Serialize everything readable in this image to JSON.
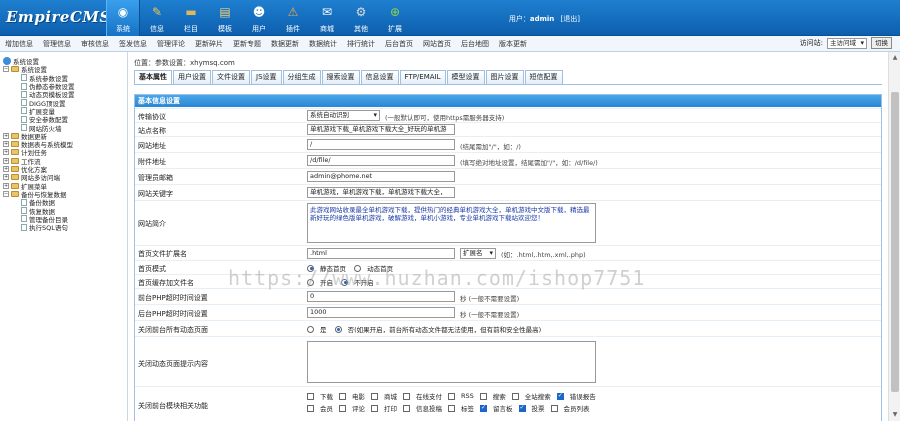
{
  "header": {
    "logo": "EmpireCMS",
    "nav": [
      {
        "label": "系统",
        "icon": "system-icon",
        "color": "#ffffff"
      },
      {
        "label": "信息",
        "icon": "edit-icon",
        "color": "#f3c64a"
      },
      {
        "label": "栏目",
        "icon": "folder-icon",
        "color": "#e0b85a"
      },
      {
        "label": "模板",
        "icon": "template-icon",
        "color": "#f1d27a"
      },
      {
        "label": "用户",
        "icon": "user-icon",
        "color": "#ffffff"
      },
      {
        "label": "插件",
        "icon": "plugin-icon",
        "color": "#f0a64a"
      },
      {
        "label": "商城",
        "icon": "shop-icon",
        "color": "#ffffff"
      },
      {
        "label": "其他",
        "icon": "gear-icon",
        "color": "#dddddd"
      },
      {
        "label": "扩展",
        "icon": "plus-icon",
        "color": "#8bd34a"
      }
    ],
    "user_prefix": "用户：",
    "user_name": "admin",
    "logout": "[退出]"
  },
  "menubar": {
    "items": [
      "增加信息",
      "管理信息",
      "审核信息",
      "签发信息",
      "管理评论",
      "更新碎片",
      "更新专题",
      "数据更新",
      "数据统计",
      "排行统计",
      "后台首页",
      "网站首页",
      "后台地图",
      "版本更新"
    ],
    "visit_label": "访问站:",
    "visit_value": "主访问域",
    "switch_button": "切换"
  },
  "sidebar": {
    "items": [
      {
        "label": "系统设置",
        "level": 0,
        "type": "root"
      },
      {
        "label": "系统设置",
        "level": 1,
        "type": "folder",
        "exp": "−"
      },
      {
        "label": "系统参数设置",
        "level": 2,
        "type": "doc"
      },
      {
        "label": "伪静态参数设置",
        "level": 2,
        "type": "doc"
      },
      {
        "label": "动态页模板设置",
        "level": 2,
        "type": "doc"
      },
      {
        "label": "DIGG顶设置",
        "level": 2,
        "type": "doc"
      },
      {
        "label": "扩展变量",
        "level": 2,
        "type": "doc"
      },
      {
        "label": "安全参数配置",
        "level": 2,
        "type": "doc"
      },
      {
        "label": "网站防火墙",
        "level": 2,
        "type": "doc"
      },
      {
        "label": "数据更新",
        "level": 1,
        "type": "folder",
        "exp": "+"
      },
      {
        "label": "数据表与系统模型",
        "level": 1,
        "type": "folder",
        "exp": "+"
      },
      {
        "label": "计划任务",
        "level": 1,
        "type": "folder",
        "exp": "+"
      },
      {
        "label": "工作流",
        "level": 1,
        "type": "folder",
        "exp": "+"
      },
      {
        "label": "优化方案",
        "level": 1,
        "type": "folder",
        "exp": "+"
      },
      {
        "label": "网站多访问端",
        "level": 1,
        "type": "folder",
        "exp": "+"
      },
      {
        "label": "扩展菜单",
        "level": 1,
        "type": "folder",
        "exp": "+"
      },
      {
        "label": "备份与恢复数据",
        "level": 1,
        "type": "folder",
        "exp": "−"
      },
      {
        "label": "备份数据",
        "level": 2,
        "type": "doc"
      },
      {
        "label": "恢复数据",
        "level": 2,
        "type": "doc"
      },
      {
        "label": "管理备份目录",
        "level": 2,
        "type": "doc"
      },
      {
        "label": "执行SQL语句",
        "level": 2,
        "type": "doc"
      }
    ]
  },
  "main": {
    "location_label": "位置：",
    "location_value": "参数设置：xhymsq.com",
    "tabs": [
      "基本属性",
      "用户设置",
      "文件设置",
      "JS设置",
      "分组生成",
      "搜索设置",
      "信息设置",
      "FTP/EMAIL",
      "模型设置",
      "图片设置",
      "短信配置"
    ],
    "section_title": "基本信息设置",
    "rows": {
      "protocol": {
        "label": "传输协议",
        "value": "系统自动识别",
        "hint": "(一般默认即可，使用https需服务器支持)"
      },
      "sitename": {
        "label": "站点名称",
        "value": "单机游戏下载_单机游戏下载大全_好玩的单机游"
      },
      "siteurl": {
        "label": "网站地址",
        "value": "/",
        "hint": "(结尾需加\"/\"，如：/)"
      },
      "fileurl": {
        "label": "附件地址",
        "value": "/d/file/",
        "hint": "(填写绝对地址设置，结尾需加\"/\"，如：/d/file/)"
      },
      "email": {
        "label": "管理员邮箱",
        "value": "admin@phome.net"
      },
      "keywords": {
        "label": "网站关键字",
        "value": "单机游戏，单机游戏下载，单机游戏下载大全，"
      },
      "intro": {
        "label": "网站简介",
        "value": "此游戏网站收录最全单机游戏下载，提供热门的经典单机游戏大全，单机游戏中文版下载，精选最新好玩的绿色版单机游戏，破解游戏，单机小游戏，专业单机游戏下载站欢迎您！"
      },
      "ext": {
        "label": "首页文件扩展名",
        "value": ".html",
        "select": "扩展名",
        "hint": "(如：.html,.htm,.xml,.php)"
      },
      "mode": {
        "label": "首页模式",
        "options": [
          "静态首页",
          "动态首页"
        ]
      },
      "suffix": {
        "label": "首页缓存加文件名",
        "options": [
          "开启",
          "不开启"
        ]
      },
      "front_time": {
        "label": "前台PHP超时时间设置",
        "value": "0",
        "hint": "秒 (一般不需要设置)"
      },
      "back_time": {
        "label": "后台PHP超时时间设置",
        "value": "1000",
        "hint": "秒 (一般不需要设置)"
      },
      "close_site": {
        "label": "关闭前台所有动态页面",
        "options": [
          "是",
          "否"
        ],
        "hint": "(如果开启，前台所有动态文件都无法使用，但有前和安全性最高)"
      },
      "close_msg": {
        "label": "关闭动态页面提示内容",
        "value": ""
      },
      "close_modules": {
        "label": "关闭前台模块相关功能",
        "row1": [
          {
            "label": "下载",
            "on": false
          },
          {
            "label": "电影",
            "on": false
          },
          {
            "label": "商城",
            "on": false
          },
          {
            "label": "在线支付",
            "on": false
          },
          {
            "label": "RSS",
            "on": false
          },
          {
            "label": "搜索",
            "on": false
          },
          {
            "label": "全站搜索",
            "on": false
          },
          {
            "label": "错误报告",
            "on": true
          }
        ],
        "row2": [
          {
            "label": "会员",
            "on": false
          },
          {
            "label": "评论",
            "on": false
          },
          {
            "label": "打印",
            "on": false
          },
          {
            "label": "信息投稿",
            "on": false
          },
          {
            "label": "标签",
            "on": false
          },
          {
            "label": "留言板",
            "on": true
          },
          {
            "label": "投票",
            "on": true
          },
          {
            "label": "会员列表",
            "on": false
          }
        ]
      }
    }
  },
  "watermark": "https://www.huzhan.com/ishop7751"
}
